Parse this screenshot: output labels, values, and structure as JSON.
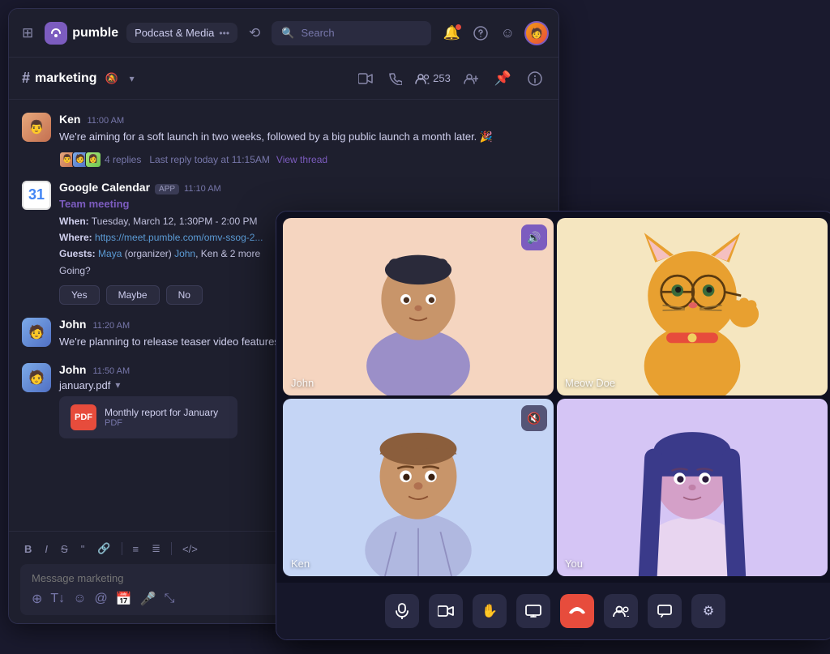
{
  "app": {
    "name": "pumble",
    "logo_initial": "p"
  },
  "topbar": {
    "workspace_name": "Podcast & Media",
    "search_placeholder": "Search",
    "history_icon": "↩",
    "notification_icon": "🔔",
    "help_icon": "?",
    "emoji_icon": "☺"
  },
  "channel": {
    "hash": "#",
    "name": "marketing",
    "member_count": "253",
    "add_member_icon": "👤+",
    "pin_icon": "📌",
    "info_icon": "ℹ"
  },
  "messages": [
    {
      "id": "msg1",
      "author": "Ken",
      "time": "11:00 AM",
      "text": "We're aiming for a soft launch in two weeks, followed by a big public launch a month later. 🎉",
      "replies_count": "4 replies",
      "last_reply": "Last reply today at 11:15AM",
      "view_thread": "View thread"
    },
    {
      "id": "gcal",
      "author": "Google Calendar",
      "badge": "APP",
      "time": "11:10 AM",
      "event_title": "Team meeting",
      "when": "Tuesday, March 12, 1:30PM - 2:00 PM",
      "where_text": "Where:",
      "where_link": "https://meet.pumble.com/omv-ssog-2...",
      "guests_text": "Guests:",
      "guests": "Maya (organizer) John, Ken & 2 more",
      "going_text": "Going?",
      "btn_yes": "Yes",
      "btn_maybe": "Maybe",
      "btn_no": "No"
    },
    {
      "id": "msg2",
      "author": "John",
      "time": "11:20 AM",
      "text": "We're planning to release teaser video features."
    },
    {
      "id": "msg3",
      "author": "John",
      "time": "11:50 AM",
      "file_label": "january.pdf",
      "file_display": "Monthly report for January",
      "file_type": "PDF"
    }
  ],
  "input": {
    "placeholder": "Message marketing",
    "fmt": {
      "bold": "B",
      "italic": "I",
      "strike": "S",
      "quote": "❝",
      "link": "🔗",
      "list_ul": "≡",
      "list_ol": "≣",
      "code": "</>",
      "more": "S"
    }
  },
  "video_call": {
    "participants": [
      {
        "id": "john",
        "name": "John",
        "audio": true,
        "cell_color": "#f5d5c0"
      },
      {
        "id": "meow",
        "name": "Meow Doe",
        "audio": true,
        "cell_color": "#f5e6c0"
      },
      {
        "id": "ken",
        "name": "Ken",
        "audio": false,
        "cell_color": "#c5d5f5"
      },
      {
        "id": "you",
        "name": "You",
        "audio": true,
        "cell_color": "#d5c5f5"
      }
    ],
    "controls": {
      "mic": "🎤",
      "video": "📹",
      "hand": "✋",
      "screen": "⬛",
      "end_call": "📞",
      "people": "👥",
      "chat": "💬",
      "settings": "⚙"
    }
  }
}
